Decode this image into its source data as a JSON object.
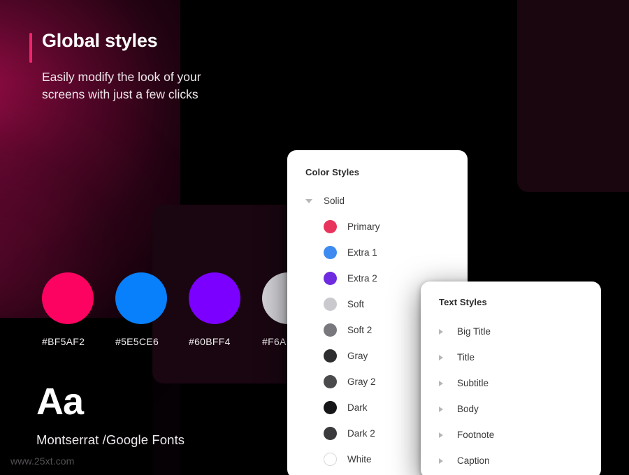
{
  "header": {
    "title": "Global styles",
    "subtitle": "Easily modify the look of your screens with just a few clicks",
    "accent_color": "#F0246B"
  },
  "swatches": [
    {
      "hex_label": "#BF5AF2",
      "color": "#FC0361",
      "name": "primary-swatch"
    },
    {
      "hex_label": "#5E5CE6",
      "color": "#0880FB",
      "name": "extra1-swatch"
    },
    {
      "hex_label": "#60BFF4",
      "color": "#7B00FF",
      "name": "extra2-swatch"
    },
    {
      "hex_label": "#F6A",
      "color": "#D2D2D7",
      "name": "soft-swatch"
    }
  ],
  "typography": {
    "sample": "Aa",
    "font_name": "Montserrat /Google Fonts"
  },
  "watermark": "www.25xt.com",
  "color_card": {
    "title": "Color Styles",
    "group_label": "Solid",
    "group_icon": "chevron-down-icon",
    "items": [
      {
        "label": "Primary",
        "color": "#E8335C"
      },
      {
        "label": "Extra 1",
        "color": "#3D8BF0"
      },
      {
        "label": "Extra 2",
        "color": "#6E2BE0"
      },
      {
        "label": "Soft",
        "color": "#C9C9CE"
      },
      {
        "label": "Soft 2",
        "color": "#78787D"
      },
      {
        "label": "Gray",
        "color": "#2E2E30"
      },
      {
        "label": "Gray 2",
        "color": "#4A4A4D"
      },
      {
        "label": "Dark",
        "color": "#161618"
      },
      {
        "label": "Dark 2",
        "color": "#3A3A3C"
      },
      {
        "label": "White",
        "color": "#FFFFFF"
      }
    ]
  },
  "text_card": {
    "title": "Text Styles",
    "items": [
      {
        "label": "Big Title",
        "icon": "chevron-right-icon"
      },
      {
        "label": "Title",
        "icon": "chevron-right-icon"
      },
      {
        "label": "Subtitle",
        "icon": "chevron-right-icon"
      },
      {
        "label": "Body",
        "icon": "chevron-right-icon"
      },
      {
        "label": "Footnote",
        "icon": "chevron-right-icon"
      },
      {
        "label": "Caption",
        "icon": "chevron-right-icon"
      }
    ]
  }
}
